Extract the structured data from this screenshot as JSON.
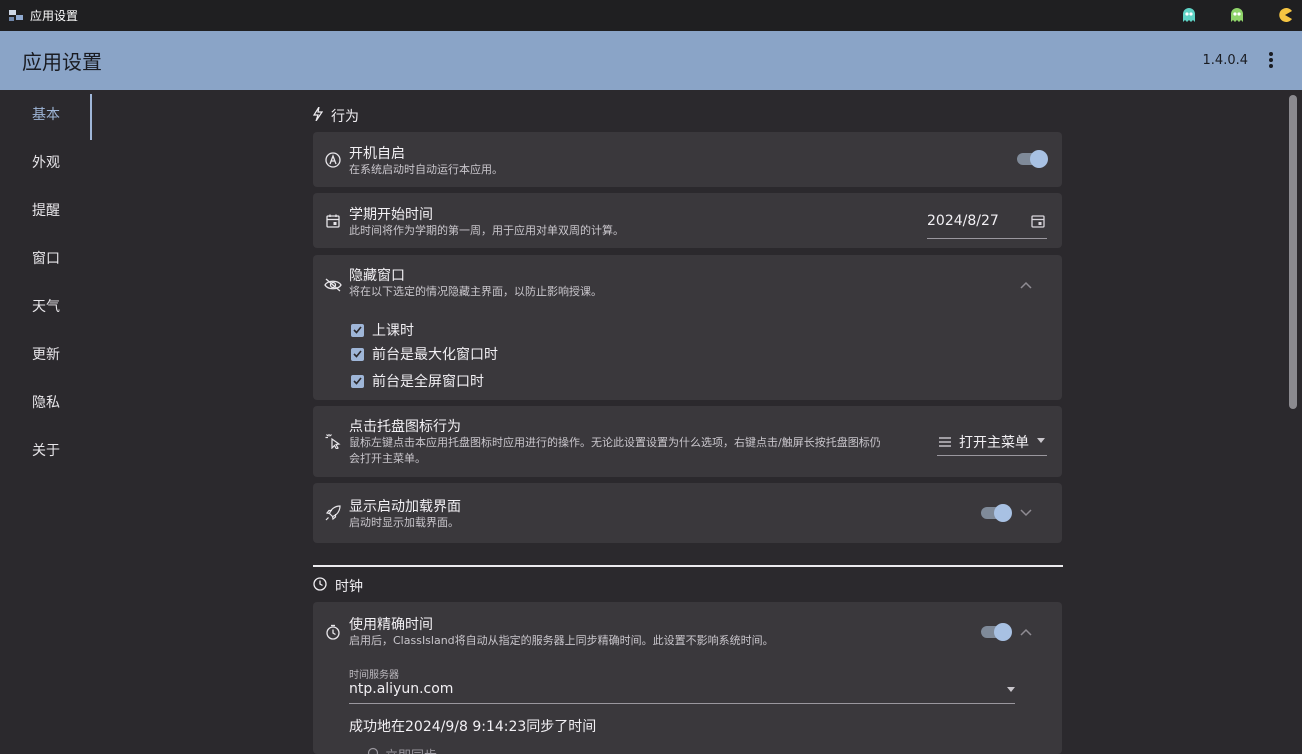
{
  "window": {
    "title": "应用设置",
    "tray_icons": [
      "ghost-cyan-icon",
      "ghost-green-icon",
      "pacman-icon"
    ]
  },
  "appbar": {
    "title": "应用设置",
    "version": "1.4.0.4",
    "more_icon": "more-vertical-icon"
  },
  "sidebar": {
    "items": [
      {
        "label": "基本",
        "active": true
      },
      {
        "label": "外观"
      },
      {
        "label": "提醒"
      },
      {
        "label": "窗口"
      },
      {
        "label": "天气"
      },
      {
        "label": "更新"
      },
      {
        "label": "隐私"
      },
      {
        "label": "关于"
      }
    ]
  },
  "behavior": {
    "title": "行为",
    "autostart": {
      "title": "开机自启",
      "desc": "在系统启动时自动运行本应用。",
      "enabled": true
    },
    "term_start": {
      "title": "学期开始时间",
      "desc": "此时间将作为学期的第一周，用于应用对单双周的计算。",
      "value": "2024/8/27"
    },
    "hide_window": {
      "title": "隐藏窗口",
      "desc": "将在以下选定的情况隐藏主界面，以防止影响授课。",
      "options": [
        {
          "label": "上课时",
          "checked": true
        },
        {
          "label": "前台是最大化窗口时",
          "checked": true
        },
        {
          "label": "前台是全屏窗口时",
          "checked": true
        }
      ]
    },
    "tray_click": {
      "title": "点击托盘图标行为",
      "desc_line1": "鼠标左键点击本应用托盘图标时应用进行的操作。无论此设置设置为什么选项，右键点击/触屏长按托盘图标仍",
      "desc_line2": "会打开主菜单。",
      "value": "打开主菜单"
    },
    "splash": {
      "title": "显示启动加载界面",
      "desc": "启动时显示加载界面。",
      "enabled": true
    }
  },
  "clock": {
    "title": "时钟",
    "exact_time": {
      "title": "使用精确时间",
      "desc": "启用后，ClassIsland将自动从指定的服务器上同步精确时间。此设置不影响系统时间。",
      "enabled": true,
      "server_label": "时间服务器",
      "server": "ntp.aliyun.com",
      "sync_status": "成功地在2024/9/8 9:14:23同步了时间",
      "sync_now": "立即同步"
    }
  },
  "colors": {
    "accent": "#9fb6d8",
    "appbar": "#8aa4c7",
    "card": "#3a383c",
    "background": "#2b292d"
  }
}
